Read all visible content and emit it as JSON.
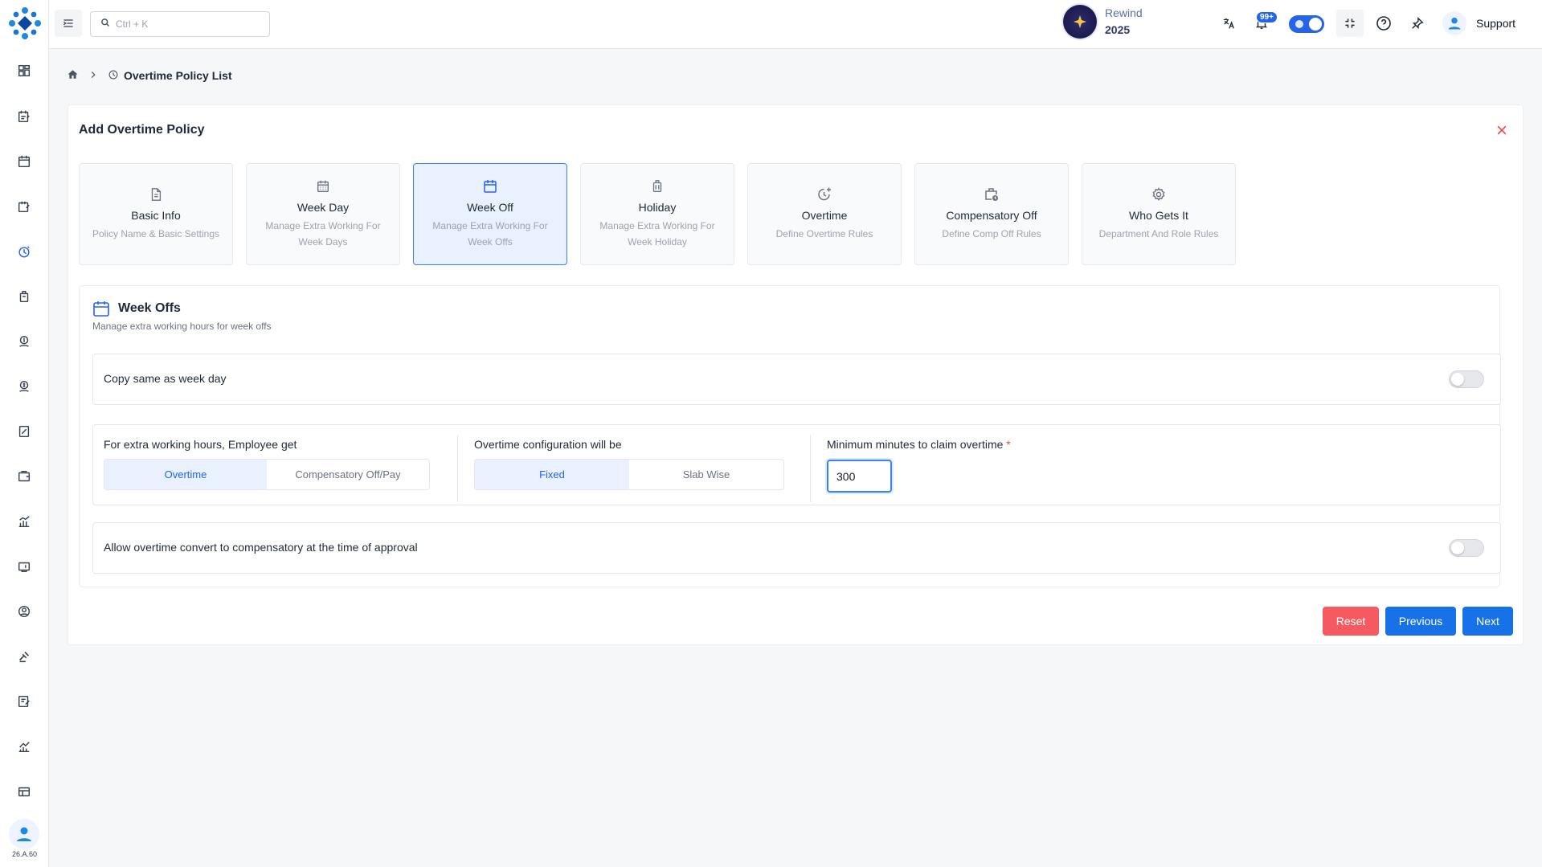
{
  "header": {
    "search_placeholder": "Ctrl + K",
    "rewind_label": "Rewind",
    "rewind_year": "2025",
    "notification_count": "99+",
    "user_name": "Support"
  },
  "sidebar": {
    "version": "26.A.60",
    "items": [
      "dashboard-icon",
      "timesheet-icon",
      "calendar-icon",
      "leave-icon",
      "overtime-icon",
      "bag-icon",
      "expense-icon",
      "payroll-icon",
      "report-icon",
      "wallet-icon",
      "analytics-icon",
      "assets-icon",
      "profile-icon",
      "legal-icon",
      "tasks-icon",
      "performance-icon",
      "settings-icon"
    ]
  },
  "breadcrumb": {
    "current": "Overtime Policy List"
  },
  "card": {
    "title": "Add Overtime Policy"
  },
  "steps": [
    {
      "title": "Basic Info",
      "subtitle": "Policy Name & Basic Settings",
      "icon": "document-icon"
    },
    {
      "title": "Week Day",
      "subtitle": "Manage Extra Working For Week Days",
      "icon": "calendar-icon"
    },
    {
      "title": "Week Off",
      "subtitle": "Manage Extra Working For Week Offs",
      "icon": "calendar-icon"
    },
    {
      "title": "Holiday",
      "subtitle": "Manage Extra Working For Week Holiday",
      "icon": "luggage-icon"
    },
    {
      "title": "Overtime",
      "subtitle": "Define Overtime Rules",
      "icon": "clock-plus-icon"
    },
    {
      "title": "Compensatory Off",
      "subtitle": "Define Comp Off Rules",
      "icon": "briefcase-clock-icon"
    },
    {
      "title": "Who Gets It",
      "subtitle": "Department And Role Rules",
      "icon": "gear-icon"
    }
  ],
  "section": {
    "title": "Week Offs",
    "subtitle": "Manage extra working hours for week offs",
    "copy_label": "Copy same as week day",
    "employee_get_label": "For extra working hours, Employee get",
    "employee_get_options": [
      "Overtime",
      "Compensatory Off/Pay"
    ],
    "employee_get_selected": "Overtime",
    "config_label": "Overtime configuration will be",
    "config_options": [
      "Fixed",
      "Slab Wise"
    ],
    "config_selected": "Fixed",
    "min_minutes_label": "Minimum minutes to claim overtime",
    "min_minutes_required": "*",
    "min_minutes_value": "300",
    "convert_label": "Allow overtime convert to compensatory at the time of approval"
  },
  "buttons": {
    "reset": "Reset",
    "previous": "Previous",
    "next": "Next"
  },
  "colors": {
    "primary": "#1672e6",
    "danger": "#f45a5f",
    "active_bg": "#e8f1fd"
  }
}
